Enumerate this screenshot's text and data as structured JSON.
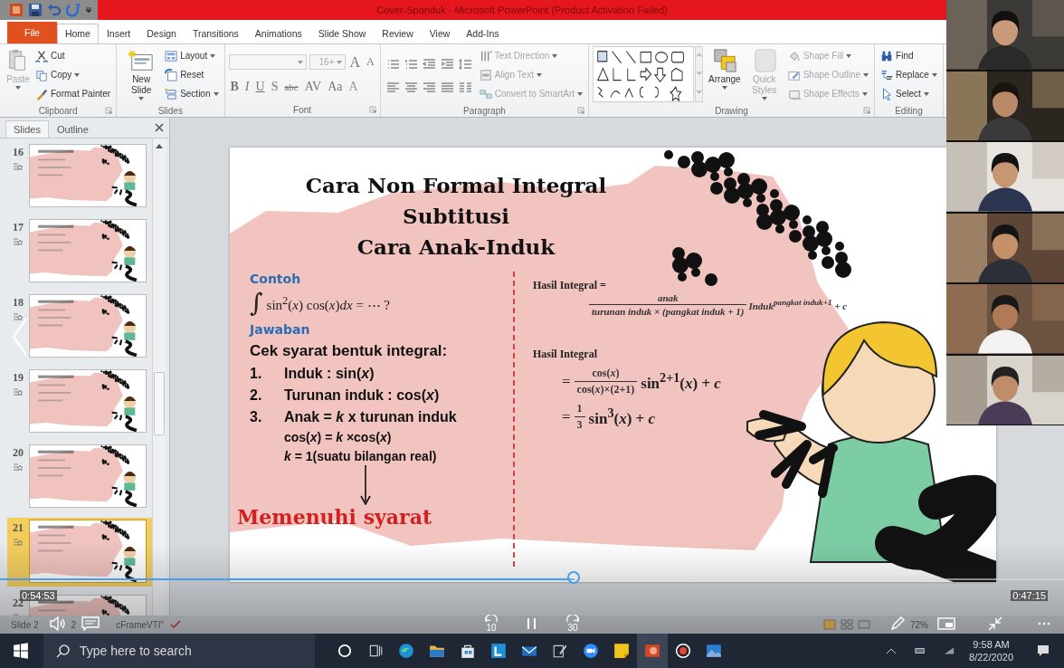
{
  "title_bar": {
    "title": "Cover-Spanduk - Microsoft PowerPoint (Product Activation Failed)"
  },
  "ribbon_tabs": [
    {
      "label": "File",
      "kind": "file",
      "selected": false
    },
    {
      "label": "Home",
      "kind": "tab",
      "selected": true
    },
    {
      "label": "Insert",
      "kind": "tab",
      "selected": false
    },
    {
      "label": "Design",
      "kind": "tab",
      "selected": false
    },
    {
      "label": "Transitions",
      "kind": "tab",
      "selected": false
    },
    {
      "label": "Animations",
      "kind": "tab",
      "selected": false
    },
    {
      "label": "Slide Show",
      "kind": "tab",
      "selected": false
    },
    {
      "label": "Review",
      "kind": "tab",
      "selected": false
    },
    {
      "label": "View",
      "kind": "tab",
      "selected": false
    },
    {
      "label": "Add-Ins",
      "kind": "tab",
      "selected": false
    }
  ],
  "ribbon_groups": [
    {
      "label": "Clipboard",
      "kind": "standard",
      "launcher": true,
      "commands": [
        {
          "label": "Paste",
          "kind": "large",
          "disabled": true,
          "dropdown": true
        },
        {
          "label": "Cut",
          "kind": "small",
          "disabled": false,
          "dropdown": false
        },
        {
          "label": "Copy",
          "kind": "small",
          "disabled": false,
          "dropdown": true
        },
        {
          "label": "Format Painter",
          "kind": "small",
          "disabled": false,
          "dropdown": false
        }
      ]
    },
    {
      "label": "Slides",
      "kind": "standard",
      "launcher": false,
      "commands": [
        {
          "label": "New Slide",
          "kind": "large",
          "disabled": false,
          "dropdown": true
        },
        {
          "label": "Layout",
          "kind": "small",
          "disabled": false,
          "dropdown": true
        },
        {
          "label": "Reset",
          "kind": "small",
          "disabled": false,
          "dropdown": false
        },
        {
          "label": "Section",
          "kind": "small",
          "disabled": false,
          "dropdown": true
        }
      ]
    },
    {
      "label": "Font",
      "kind": "font",
      "launcher": true,
      "top_controls": [
        {
          "kind": "field"
        },
        {
          "kind": "field",
          "label": "16+"
        },
        {
          "kind": "glyph",
          "label": "A"
        },
        {
          "kind": "glyph",
          "label": "A"
        }
      ],
      "bottom_controls": [
        {
          "kind": "glyph",
          "label": "B"
        },
        {
          "kind": "glyph",
          "label": "I"
        },
        {
          "kind": "glyph",
          "label": "U"
        },
        {
          "kind": "glyph",
          "label": "S"
        },
        {
          "kind": "glyph",
          "label": "abc"
        },
        {
          "kind": "glyph",
          "label": "AV"
        },
        {
          "kind": "glyph",
          "label": "Aa"
        },
        {
          "kind": "glyph",
          "label": "A"
        }
      ]
    },
    {
      "label": "Paragraph",
      "kind": "paragraph",
      "launcher": true,
      "commands": [
        {
          "label": "Text Direction",
          "kind": "small",
          "disabled": true,
          "dropdown": true
        },
        {
          "label": "Align Text",
          "kind": "small",
          "disabled": true,
          "dropdown": true
        },
        {
          "label": "Convert to SmartArt",
          "kind": "small",
          "disabled": true,
          "dropdown": true
        }
      ]
    },
    {
      "label": "Drawing",
      "kind": "drawing",
      "launcher": true,
      "commands": [
        {
          "label": "Arrange",
          "kind": "large",
          "disabled": false,
          "dropdown": true
        },
        {
          "label": "Quick Styles",
          "kind": "large",
          "disabled": true,
          "dropdown": true
        },
        {
          "label": "Shape Fill",
          "kind": "small",
          "disabled": true,
          "dropdown": true
        },
        {
          "label": "Shape Outline",
          "kind": "small",
          "disabled": true,
          "dropdown": true
        },
        {
          "label": "Shape Effects",
          "kind": "small",
          "disabled": true,
          "dropdown": true
        }
      ]
    },
    {
      "label": "Editing",
      "kind": "standard",
      "launcher": false,
      "commands": [
        {
          "label": "Find",
          "kind": "small",
          "disabled": false,
          "dropdown": false
        },
        {
          "label": "Replace",
          "kind": "small",
          "disabled": false,
          "dropdown": true
        },
        {
          "label": "Select",
          "kind": "small",
          "disabled": false,
          "dropdown": true
        }
      ]
    }
  ],
  "slides_panel": {
    "tabs": [
      {
        "label": "Slides",
        "selected": true
      },
      {
        "label": "Outline",
        "selected": false
      }
    ],
    "thumbnails": [
      {
        "number": "16",
        "selected": false
      },
      {
        "number": "17",
        "selected": false
      },
      {
        "number": "18",
        "selected": false
      },
      {
        "number": "19",
        "selected": false
      },
      {
        "number": "20",
        "selected": false
      },
      {
        "number": "21",
        "selected": true
      },
      {
        "number": "22",
        "selected": false
      }
    ]
  },
  "slide": {
    "title_lines": [
      "Cara Non Formal Integral",
      "Subtitusi",
      "Cara Anak-Induk"
    ],
    "example_label": "Contoh",
    "integral_sign": "∫",
    "example": "sin$^{2}$(*x*) cos(*x*)*dx* = ⋯ ?",
    "answer_label": "Jawaban",
    "check_heading": "Cek syarat bentuk integral:",
    "conditions": [
      {
        "number": "1.",
        "text": "Induk : sin(*x*)"
      },
      {
        "number": "2.",
        "text": "Turunan induk : cos(*x*)"
      },
      {
        "number": "3.",
        "text": "Anak = *k* x turunan induk"
      }
    ],
    "notes": [
      "cos(*x*) = *k* ×cos(*x*)",
      "*k* = 1(suatu bilangan real)"
    ],
    "conclusion": "Memenuhi syarat",
    "result_heading": "Hasil Integral =",
    "formula": {
      "numerator": "anak",
      "denominator": "turunan induk × (pangkat induk + 1)",
      "tail": "Induk$^{pangkat induk+1}$ + *c*"
    },
    "result_heading_2": "Hasil Integral",
    "steps": [
      {
        "prefix": "=",
        "numerator": "cos(*x*)",
        "denominator": "cos(*x*)×(2+1)",
        "tail": "sin$^{2+1}$(*x*) + *c*"
      },
      {
        "prefix": "=",
        "numerator": "1",
        "denominator": "3",
        "tail": "sin$^{3}$(*x*) + *c*"
      }
    ]
  },
  "video": {
    "elapsed": "0:54:53",
    "remaining": "0:47:15",
    "level": 0.54,
    "skip_back": "10",
    "skip_forward": "30"
  },
  "status_bar": {
    "slide_label": "Slide 2",
    "slide_count": "2",
    "theme": "cFrameVTI\"",
    "zoom": "72%"
  },
  "taskbar": {
    "search_placeholder": "Type here to search",
    "time": "9:58 AM",
    "date": "8/22/2020"
  }
}
